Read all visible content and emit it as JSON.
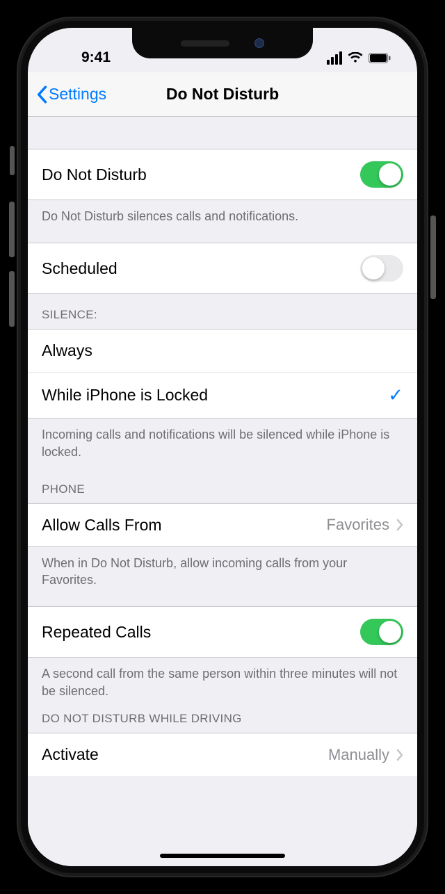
{
  "status": {
    "time": "9:41"
  },
  "nav": {
    "back_label": "Settings",
    "title": "Do Not Disturb"
  },
  "dnd": {
    "label": "Do Not Disturb",
    "enabled": true,
    "footer": "Do Not Disturb silences calls and notifications."
  },
  "scheduled": {
    "label": "Scheduled",
    "enabled": false
  },
  "silence": {
    "header": "SILENCE:",
    "options": [
      {
        "label": "Always",
        "selected": false
      },
      {
        "label": "While iPhone is Locked",
        "selected": true
      }
    ],
    "footer": "Incoming calls and notifications will be silenced while iPhone is locked."
  },
  "phone": {
    "header": "PHONE",
    "allow_calls": {
      "label": "Allow Calls From",
      "value": "Favorites"
    },
    "allow_calls_footer": "When in Do Not Disturb, allow incoming calls from your Favorites.",
    "repeated": {
      "label": "Repeated Calls",
      "enabled": true
    },
    "repeated_footer": "A second call from the same person within three minutes will not be silenced."
  },
  "driving": {
    "header": "DO NOT DISTURB WHILE DRIVING",
    "activate": {
      "label": "Activate",
      "value": "Manually"
    }
  }
}
